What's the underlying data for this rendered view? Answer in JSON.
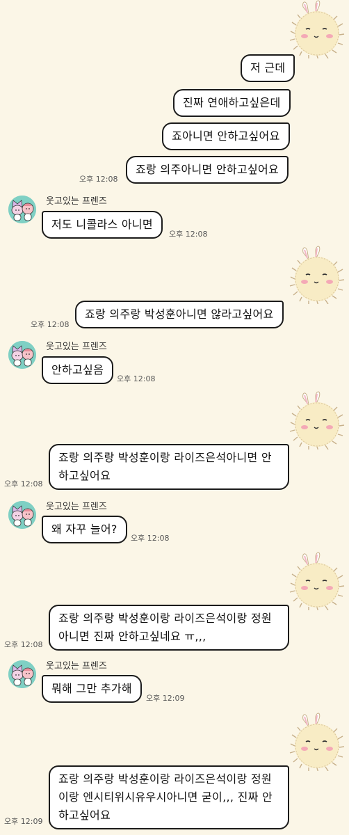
{
  "friend": {
    "name": "웃고있는 프렌즈"
  },
  "icons": {
    "my_avatar": "fluffy-bunny-icon",
    "friend_avatar": "friends-avatar-icon"
  },
  "colors": {
    "background": "#fbf6e7",
    "bubble": "#ffffff",
    "avatar_bg": "#7fd0c4"
  },
  "messages": [
    {
      "sender": "me",
      "text": "저 근데"
    },
    {
      "sender": "me",
      "text": "진짜 연애하고싶은데"
    },
    {
      "sender": "me",
      "text": "죠아니면 안하고싶어요"
    },
    {
      "sender": "me",
      "text": "죠랑 의주아니면 안하고싶어요",
      "time": "오후 12:08"
    },
    {
      "sender": "friend",
      "text": "저도 니콜라스 아니면",
      "time": "오후 12:08"
    },
    {
      "sender": "me",
      "text": "죠랑 의주랑 박성훈아니면 않라고싶어요",
      "time": "오후 12:08"
    },
    {
      "sender": "friend",
      "text": "안하고싶음",
      "time": "오후 12:08"
    },
    {
      "sender": "me",
      "text": "죠랑 의주랑 박성훈이랑 라이즈은석아니면 안\n하고싶어요",
      "time": "오후 12:08"
    },
    {
      "sender": "friend",
      "text": "왜 자꾸 늘어?",
      "time": "오후 12:08"
    },
    {
      "sender": "me",
      "text": "죠랑 의주랑 박성훈이랑 라이즈은석이랑 정원\n아니면 진짜 안하고싶네요 ㅠ,,,",
      "time": "오후 12:08"
    },
    {
      "sender": "friend",
      "text": "뭐해 그만 추가해",
      "time": "오후 12:09"
    },
    {
      "sender": "me",
      "text": "죠랑 의주랑 박성훈이랑 라이즈은석이랑 정원\n이랑 엔시티위시유우시아니면 굳이,,, 진짜 안\n하고싶어요",
      "time": "오후 12:09"
    }
  ]
}
